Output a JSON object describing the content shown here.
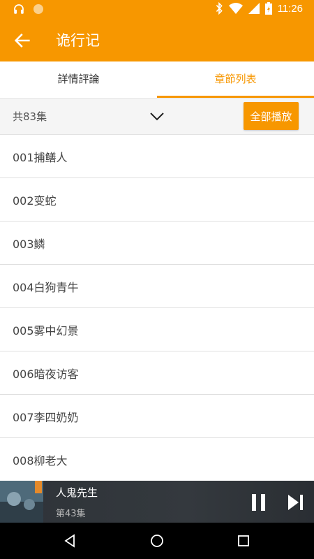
{
  "status_bar": {
    "time": "11:26"
  },
  "app_bar": {
    "title": "诡行记"
  },
  "tabs": [
    {
      "label": "詳情評論",
      "active": false
    },
    {
      "label": "章節列表",
      "active": true
    }
  ],
  "episode_header": {
    "count_label": "共83集",
    "play_all_label": "全部播放"
  },
  "episodes": [
    "001捕鳝人",
    "002变蛇",
    "003鳞",
    "004白狗青牛",
    "005雾中幻景",
    "006暗夜访客",
    "007李四奶奶",
    "008柳老大"
  ],
  "player": {
    "title": "人鬼先生",
    "subtitle": "第43集"
  },
  "colors": {
    "accent": "#f79700",
    "player_bg": "#31363b"
  }
}
